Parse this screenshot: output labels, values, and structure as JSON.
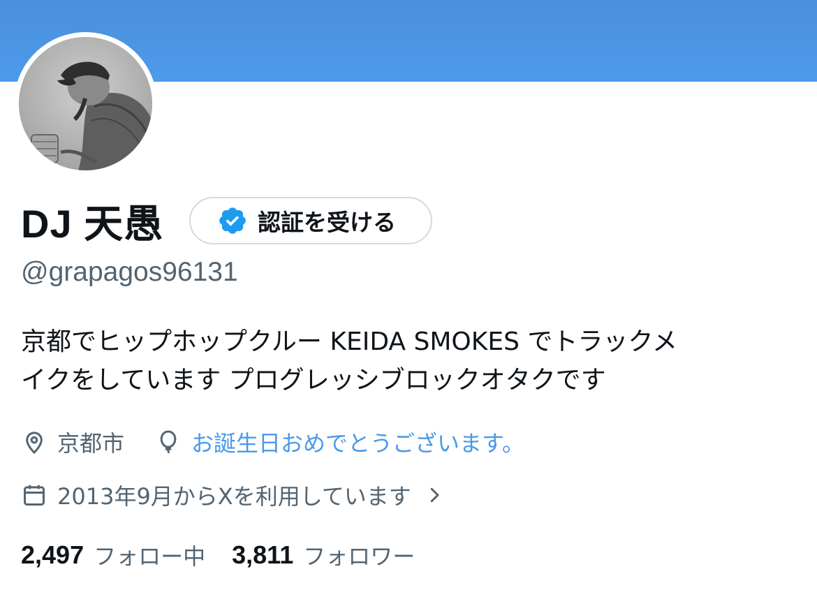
{
  "profile": {
    "display_name": "DJ 天愚",
    "verify_button_label": "認証を受ける",
    "handle": "@grapagos96131",
    "bio_lines": [
      "京都でヒップホップクルー KEIDA SMOKES でトラックメ",
      "イクをしています プログレッシブロックオタクです"
    ],
    "location": "京都市",
    "birthday_message": "お誕生日おめでとうございます。",
    "joined": "2013年9月からXを利用しています",
    "following_count": "2,497",
    "following_label": "フォロー中",
    "followers_count": "3,811",
    "followers_label": "フォロワー"
  },
  "icons": {
    "badge": "verified-badge-icon",
    "location": "location-pin-icon",
    "birthday": "balloon-icon",
    "calendar": "calendar-icon",
    "chevron": "chevron-right-icon"
  },
  "colors": {
    "banner": "#4d9bea",
    "accent_link": "#4a99e9",
    "badge": "#1d9bf0",
    "secondary_text": "#536471",
    "primary_text": "#0f1419"
  }
}
